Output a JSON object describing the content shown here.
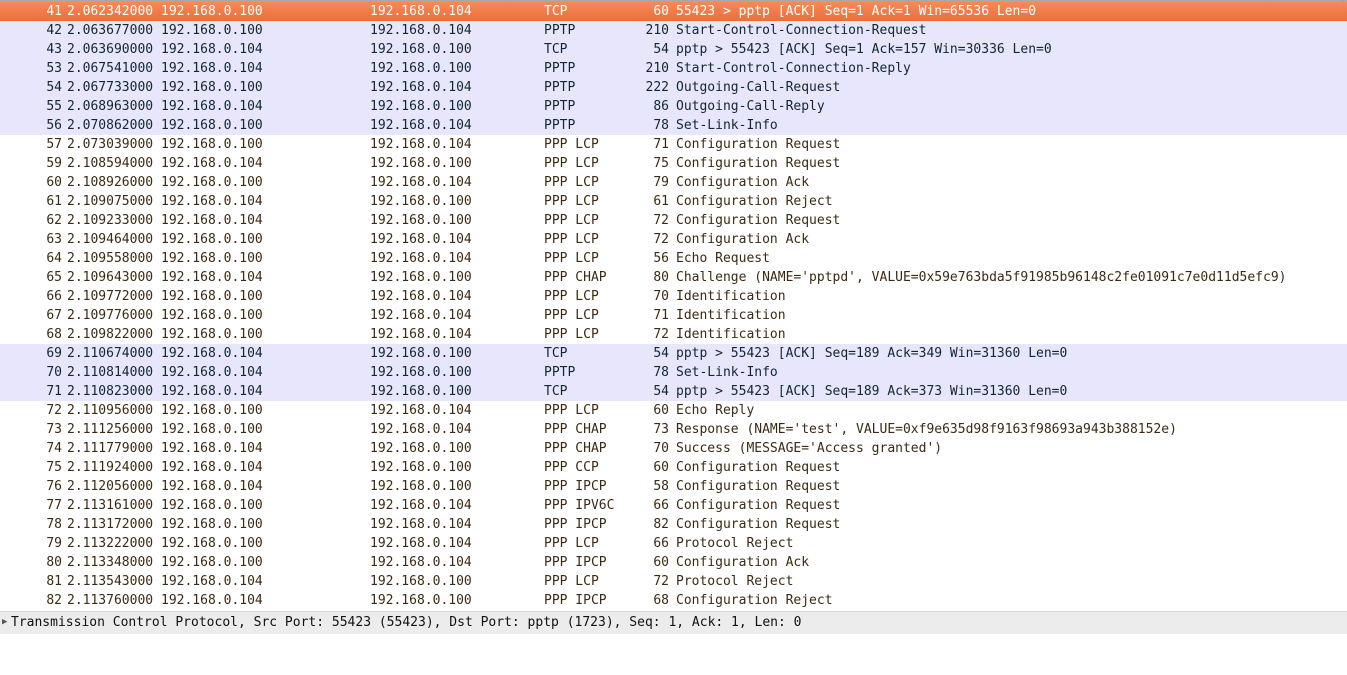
{
  "colors": {
    "selected": "#ec6e3a",
    "tcp_row": "#e7e6fc",
    "ppp_row": "#ffffff"
  },
  "packets": [
    {
      "no": "41",
      "time": "2.062342000",
      "src": "192.168.0.100",
      "dst": "192.168.0.104",
      "proto": "TCP",
      "len": "60",
      "info": "55423 > pptp [ACK] Seq=1 Ack=1 Win=65536 Len=0",
      "cls": "sel"
    },
    {
      "no": "42",
      "time": "2.063677000",
      "src": "192.168.0.100",
      "dst": "192.168.0.104",
      "proto": "PPTP",
      "len": "210",
      "info": "Start-Control-Connection-Request",
      "cls": "tcp"
    },
    {
      "no": "43",
      "time": "2.063690000",
      "src": "192.168.0.104",
      "dst": "192.168.0.100",
      "proto": "TCP",
      "len": "54",
      "info": "pptp > 55423 [ACK] Seq=1 Ack=157 Win=30336 Len=0",
      "cls": "tcp"
    },
    {
      "no": "53",
      "time": "2.067541000",
      "src": "192.168.0.104",
      "dst": "192.168.0.100",
      "proto": "PPTP",
      "len": "210",
      "info": "Start-Control-Connection-Reply",
      "cls": "tcp"
    },
    {
      "no": "54",
      "time": "2.067733000",
      "src": "192.168.0.100",
      "dst": "192.168.0.104",
      "proto": "PPTP",
      "len": "222",
      "info": "Outgoing-Call-Request",
      "cls": "tcp"
    },
    {
      "no": "55",
      "time": "2.068963000",
      "src": "192.168.0.104",
      "dst": "192.168.0.100",
      "proto": "PPTP",
      "len": "86",
      "info": "Outgoing-Call-Reply",
      "cls": "tcp"
    },
    {
      "no": "56",
      "time": "2.070862000",
      "src": "192.168.0.100",
      "dst": "192.168.0.104",
      "proto": "PPTP",
      "len": "78",
      "info": "Set-Link-Info",
      "cls": "tcp"
    },
    {
      "no": "57",
      "time": "2.073039000",
      "src": "192.168.0.100",
      "dst": "192.168.0.104",
      "proto": "PPP LCP",
      "len": "71",
      "info": "Configuration Request",
      "cls": "ppp"
    },
    {
      "no": "59",
      "time": "2.108594000",
      "src": "192.168.0.104",
      "dst": "192.168.0.100",
      "proto": "PPP LCP",
      "len": "75",
      "info": "Configuration Request",
      "cls": "ppp"
    },
    {
      "no": "60",
      "time": "2.108926000",
      "src": "192.168.0.100",
      "dst": "192.168.0.104",
      "proto": "PPP LCP",
      "len": "79",
      "info": "Configuration Ack",
      "cls": "ppp"
    },
    {
      "no": "61",
      "time": "2.109075000",
      "src": "192.168.0.104",
      "dst": "192.168.0.100",
      "proto": "PPP LCP",
      "len": "61",
      "info": "Configuration Reject",
      "cls": "ppp"
    },
    {
      "no": "62",
      "time": "2.109233000",
      "src": "192.168.0.104",
      "dst": "192.168.0.100",
      "proto": "PPP LCP",
      "len": "72",
      "info": "Configuration Request",
      "cls": "ppp"
    },
    {
      "no": "63",
      "time": "2.109464000",
      "src": "192.168.0.100",
      "dst": "192.168.0.104",
      "proto": "PPP LCP",
      "len": "72",
      "info": "Configuration Ack",
      "cls": "ppp"
    },
    {
      "no": "64",
      "time": "2.109558000",
      "src": "192.168.0.100",
      "dst": "192.168.0.104",
      "proto": "PPP LCP",
      "len": "56",
      "info": "Echo Request",
      "cls": "ppp"
    },
    {
      "no": "65",
      "time": "2.109643000",
      "src": "192.168.0.104",
      "dst": "192.168.0.100",
      "proto": "PPP CHAP",
      "len": "80",
      "info": "Challenge (NAME='pptpd', VALUE=0x59e763bda5f91985b96148c2fe01091c7e0d11d5efc9)",
      "cls": "ppp"
    },
    {
      "no": "66",
      "time": "2.109772000",
      "src": "192.168.0.100",
      "dst": "192.168.0.104",
      "proto": "PPP LCP",
      "len": "70",
      "info": "Identification",
      "cls": "ppp"
    },
    {
      "no": "67",
      "time": "2.109776000",
      "src": "192.168.0.100",
      "dst": "192.168.0.104",
      "proto": "PPP LCP",
      "len": "71",
      "info": "Identification",
      "cls": "ppp"
    },
    {
      "no": "68",
      "time": "2.109822000",
      "src": "192.168.0.100",
      "dst": "192.168.0.104",
      "proto": "PPP LCP",
      "len": "72",
      "info": "Identification",
      "cls": "ppp"
    },
    {
      "no": "69",
      "time": "2.110674000",
      "src": "192.168.0.104",
      "dst": "192.168.0.100",
      "proto": "TCP",
      "len": "54",
      "info": "pptp > 55423 [ACK] Seq=189 Ack=349 Win=31360 Len=0",
      "cls": "tcp"
    },
    {
      "no": "70",
      "time": "2.110814000",
      "src": "192.168.0.104",
      "dst": "192.168.0.100",
      "proto": "PPTP",
      "len": "78",
      "info": "Set-Link-Info",
      "cls": "tcp"
    },
    {
      "no": "71",
      "time": "2.110823000",
      "src": "192.168.0.104",
      "dst": "192.168.0.100",
      "proto": "TCP",
      "len": "54",
      "info": "pptp > 55423 [ACK] Seq=189 Ack=373 Win=31360 Len=0",
      "cls": "tcp"
    },
    {
      "no": "72",
      "time": "2.110956000",
      "src": "192.168.0.100",
      "dst": "192.168.0.104",
      "proto": "PPP LCP",
      "len": "60",
      "info": "Echo Reply",
      "cls": "ppp"
    },
    {
      "no": "73",
      "time": "2.111256000",
      "src": "192.168.0.100",
      "dst": "192.168.0.104",
      "proto": "PPP CHAP",
      "len": "73",
      "info": "Response (NAME='test', VALUE=0xf9e635d98f9163f98693a943b388152e)",
      "cls": "ppp"
    },
    {
      "no": "74",
      "time": "2.111779000",
      "src": "192.168.0.104",
      "dst": "192.168.0.100",
      "proto": "PPP CHAP",
      "len": "70",
      "info": "Success (MESSAGE='Access granted')",
      "cls": "ppp"
    },
    {
      "no": "75",
      "time": "2.111924000",
      "src": "192.168.0.104",
      "dst": "192.168.0.100",
      "proto": "PPP CCP",
      "len": "60",
      "info": "Configuration Request",
      "cls": "ppp"
    },
    {
      "no": "76",
      "time": "2.112056000",
      "src": "192.168.0.104",
      "dst": "192.168.0.100",
      "proto": "PPP IPCP",
      "len": "58",
      "info": "Configuration Request",
      "cls": "ppp"
    },
    {
      "no": "77",
      "time": "2.113161000",
      "src": "192.168.0.100",
      "dst": "192.168.0.104",
      "proto": "PPP IPV6C",
      "len": "66",
      "info": "Configuration Request",
      "cls": "ppp"
    },
    {
      "no": "78",
      "time": "2.113172000",
      "src": "192.168.0.100",
      "dst": "192.168.0.104",
      "proto": "PPP IPCP",
      "len": "82",
      "info": "Configuration Request",
      "cls": "ppp"
    },
    {
      "no": "79",
      "time": "2.113222000",
      "src": "192.168.0.100",
      "dst": "192.168.0.104",
      "proto": "PPP LCP",
      "len": "66",
      "info": "Protocol Reject",
      "cls": "ppp"
    },
    {
      "no": "80",
      "time": "2.113348000",
      "src": "192.168.0.100",
      "dst": "192.168.0.104",
      "proto": "PPP IPCP",
      "len": "60",
      "info": "Configuration Ack",
      "cls": "ppp"
    },
    {
      "no": "81",
      "time": "2.113543000",
      "src": "192.168.0.104",
      "dst": "192.168.0.100",
      "proto": "PPP LCP",
      "len": "72",
      "info": "Protocol Reject",
      "cls": "ppp"
    },
    {
      "no": "82",
      "time": "2.113760000",
      "src": "192.168.0.104",
      "dst": "192.168.0.100",
      "proto": "PPP IPCP",
      "len": "68",
      "info": "Configuration Reject",
      "cls": "ppp"
    }
  ],
  "details": {
    "expander_icon": "triangle-right",
    "text": "Transmission Control Protocol, Src Port: 55423 (55423), Dst Port: pptp (1723), Seq: 1, Ack: 1, Len: 0"
  }
}
